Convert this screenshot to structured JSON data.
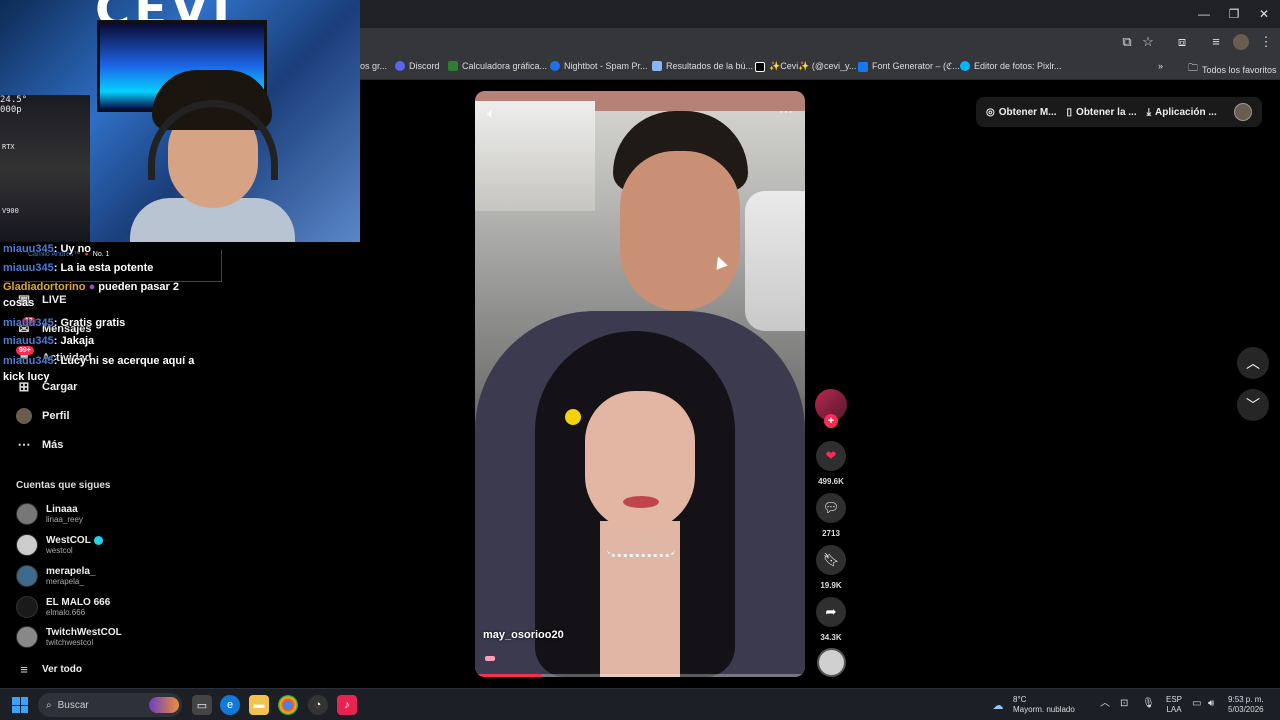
{
  "browser": {
    "bookmarks": [
      {
        "label": "os gr...",
        "color": "#888888"
      },
      {
        "label": "Discord",
        "color": "#5865f2"
      },
      {
        "label": "Calculadora gráfica...",
        "color": "#2e7d32"
      },
      {
        "label": "Nightbot - Spam Pr...",
        "color": "#1f6feb"
      },
      {
        "label": "Resultados de la bú...",
        "color": "#8ab4f8"
      },
      {
        "label": "✨Cevi✨ (@cevi_y...",
        "color": "#000000"
      },
      {
        "label": "Font Generator – (ℭ...",
        "color": "#1877f2"
      },
      {
        "label": "Editor de fotos: Pixlr...",
        "color": "#00b4ff"
      }
    ],
    "all_favorites": "Todos los favoritos"
  },
  "webcam": {
    "wall_text": "CEVI",
    "lab_top": "24.5°",
    "lab_2": "000p",
    "lab_rtx": "RTX",
    "lab_v900": "V900"
  },
  "chat": [
    {
      "user": "miauu345",
      "msg": ": Uy no"
    },
    {
      "user": "miauu345",
      "msg": ": La ia esta potente"
    },
    {
      "user": "Gladiadortorino",
      "msg": " pueden pasar 2"
    },
    {
      "user": "",
      "msg": "cosas"
    },
    {
      "user": "miauu345",
      "msg": ": Gratis gratis"
    },
    {
      "user": "miauu345",
      "msg": ": Jakaja"
    },
    {
      "user": "miauu345",
      "msg": ": Lucy ni se acerque aquí a"
    },
    {
      "user": "",
      "msg": "kick lucy"
    }
  ],
  "overlay_tag": {
    "name": "Camilo Andrés™",
    "rank": "No. 1"
  },
  "sidebar": {
    "items": [
      {
        "label": "LIVE",
        "icon": "live-icon"
      },
      {
        "label": "Mensajes",
        "icon": "messages-icon",
        "badge": "13"
      },
      {
        "label": "Actividad",
        "icon": "activity-icon",
        "badge": "99+"
      },
      {
        "label": "Cargar",
        "icon": "upload-icon"
      },
      {
        "label": "Perfil",
        "icon": "profile-icon"
      },
      {
        "label": "Más",
        "icon": "more-icon"
      }
    ],
    "following_title": "Cuentas que sigues",
    "following": [
      {
        "name": "Linaaa",
        "handle": "linaa_reey",
        "verified": false
      },
      {
        "name": "WestCOL",
        "handle": "westcol",
        "verified": true
      },
      {
        "name": "merapela_",
        "handle": "merapela_",
        "verified": false
      },
      {
        "name": "EL MALO 666",
        "handle": "elmalo.666",
        "verified": false
      },
      {
        "name": "TwitchWestCOL",
        "handle": "twitchwestcol",
        "verified": false
      }
    ],
    "see_all": "Ver todo"
  },
  "video": {
    "username": "may_osorioo20",
    "progress": 0.2
  },
  "actions": {
    "likes": "499.6K",
    "comments": "2713",
    "saves": "19.9K",
    "shares": "34.3K"
  },
  "topbar": {
    "item1": "Obtener M...",
    "item2": "Obtener la ...",
    "item3": "Aplicación ..."
  },
  "taskbar": {
    "search": "Buscar",
    "weather_temp": "8°C",
    "weather_desc": "Mayorm. nublado",
    "lang1": "ESP",
    "lang2": "LAA",
    "time": "9:53 p. m.",
    "date": "5/03/2026"
  }
}
